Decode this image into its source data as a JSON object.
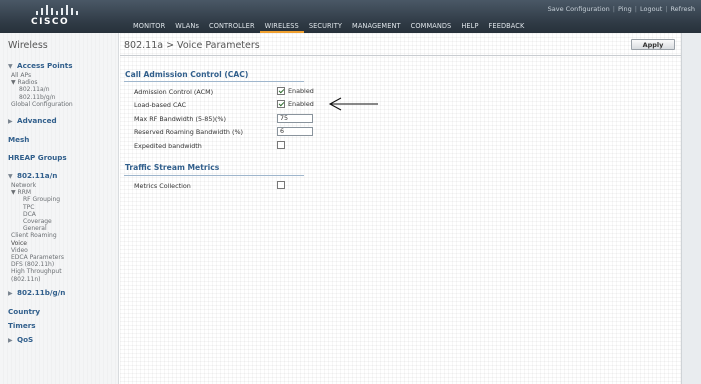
{
  "brand": {
    "name": "CISCO"
  },
  "utility_links": [
    {
      "label": "Save Configuration"
    },
    {
      "label": "Ping"
    },
    {
      "label": "Logout"
    },
    {
      "label": "Refresh"
    }
  ],
  "nav": [
    {
      "label": "MONITOR"
    },
    {
      "label": "WLANs"
    },
    {
      "label": "CONTROLLER"
    },
    {
      "label": "WIRELESS"
    },
    {
      "label": "SECURITY"
    },
    {
      "label": "MANAGEMENT"
    },
    {
      "label": "COMMANDS"
    },
    {
      "label": "HELP"
    },
    {
      "label": "FEEDBACK"
    }
  ],
  "sidebar": {
    "title": "Wireless",
    "access_points": "Access Points",
    "all_aps": "All APs",
    "radios": "Radios",
    "r_80211a": "802.11a/n",
    "r_80211b": "802.11b/g/n",
    "global_config": "Global Configuration",
    "advanced": "Advanced",
    "mesh": "Mesh",
    "hreap": "HREAP Groups",
    "a_group": "802.11a/n",
    "network": "Network",
    "rrm": "RRM",
    "rf_grouping": "RF Grouping",
    "tpc": "TPC",
    "dca": "DCA",
    "coverage": "Coverage",
    "general": "General",
    "client_roaming": "Client Roaming",
    "voice": "Voice",
    "video": "Video",
    "edca": "EDCA Parameters",
    "dfs": "DFS (802.11h)",
    "high_throughput": "High Throughput",
    "high_throughput_sub": "(802.11n)",
    "b_group": "802.11b/g/n",
    "country": "Country",
    "timers": "Timers",
    "qos": "QoS"
  },
  "main": {
    "title": "802.11a > Voice Parameters",
    "apply_label": "Apply",
    "cac_title": "Call Admission Control (CAC)",
    "cac_rows": {
      "acm_label": "Admission Control (ACM)",
      "acm_value": "Enabled",
      "lb_label": "Load-based CAC",
      "lb_value": "Enabled",
      "max_rf_label": "Max RF Bandwidth (5-85)(%)",
      "max_rf_value": "75",
      "reserved_label": "Reserved Roaming Bandwidth (%)",
      "reserved_value": "6",
      "expedited_label": "Expedited bandwidth"
    },
    "tsm_title": "Traffic Stream Metrics",
    "metrics_label": "Metrics Collection"
  },
  "colors": {
    "header": "#2f3a45",
    "accent": "#f0a030",
    "section_title": "#315f8c"
  }
}
